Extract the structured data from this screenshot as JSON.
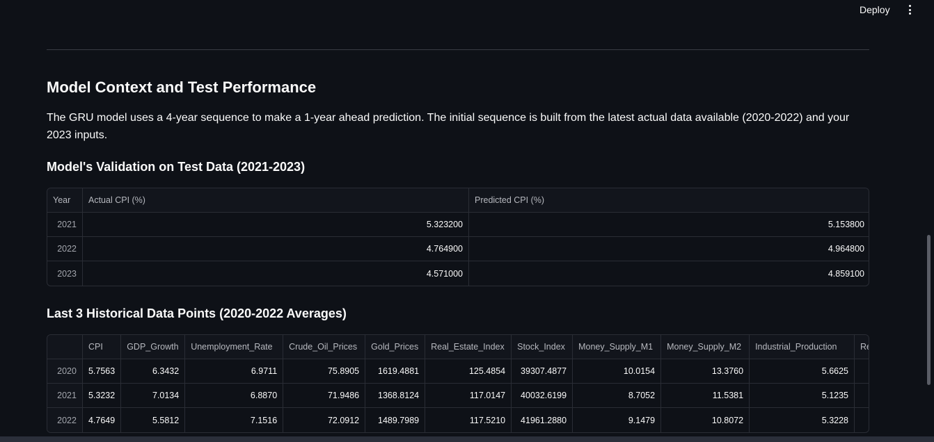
{
  "header": {
    "deploy_label": "Deploy"
  },
  "section": {
    "title": "Model Context and Test Performance",
    "description": "The GRU model uses a 4-year sequence to make a 1-year ahead prediction. The initial sequence is built from the latest actual data available (2020-2022) and your 2023 inputs."
  },
  "validation": {
    "title": "Model's Validation on Test Data (2021-2023)",
    "columns": [
      "Year",
      "Actual CPI (%)",
      "Predicted CPI (%)"
    ],
    "rows": [
      [
        "2021",
        "5.323200",
        "5.153800"
      ],
      [
        "2022",
        "4.764900",
        "4.964800"
      ],
      [
        "2023",
        "4.571000",
        "4.859100"
      ]
    ]
  },
  "historical": {
    "title": "Last 3 Historical Data Points (2020-2022 Averages)",
    "columns": [
      "",
      "CPI",
      "GDP_Growth",
      "Unemployment_Rate",
      "Crude_Oil_Prices",
      "Gold_Prices",
      "Real_Estate_Index",
      "Stock_Index",
      "Money_Supply_M1",
      "Money_Supply_M2",
      "Industrial_Production",
      "Ret"
    ],
    "rows": [
      [
        "2020",
        "5.7563",
        "6.3432",
        "6.9711",
        "75.8905",
        "1619.4881",
        "125.4854",
        "39307.4877",
        "10.0154",
        "13.3760",
        "5.6625",
        ""
      ],
      [
        "2021",
        "5.3232",
        "7.0134",
        "6.8870",
        "71.9486",
        "1368.8124",
        "117.0147",
        "40032.6199",
        "8.7052",
        "11.5381",
        "5.1235",
        ""
      ],
      [
        "2022",
        "4.7649",
        "5.5812",
        "7.1516",
        "72.0912",
        "1489.7989",
        "117.5210",
        "41961.2880",
        "9.1479",
        "10.8072",
        "5.3228",
        ""
      ]
    ]
  }
}
